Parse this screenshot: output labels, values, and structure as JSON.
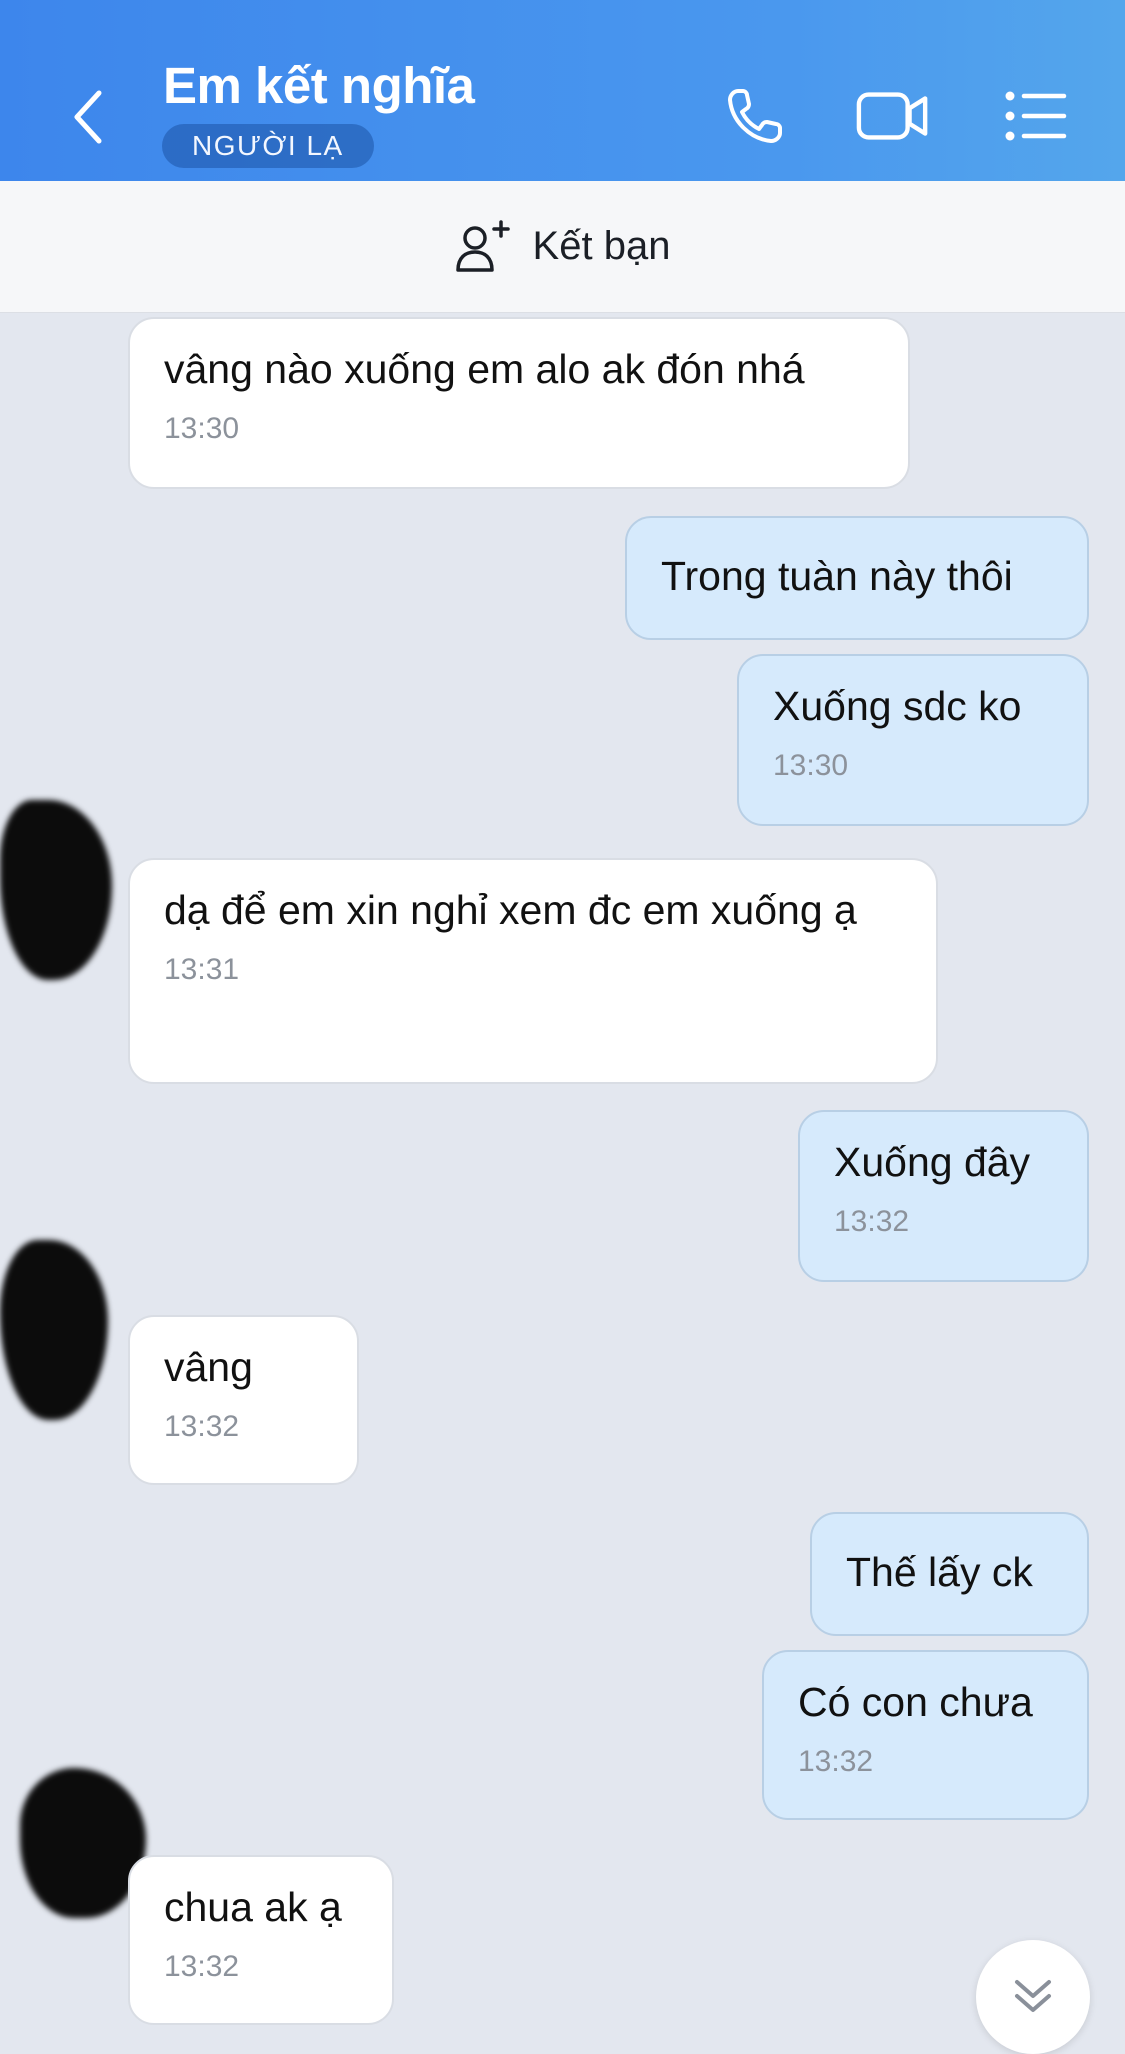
{
  "header": {
    "title": "Em kết nghĩa",
    "badge": "NGƯỜI LẠ"
  },
  "add_friend": {
    "label": "Kết bạn"
  },
  "messages": [
    {
      "side": "received",
      "text": "vâng nào xuống em alo ak đón nhá",
      "time": "13:30"
    },
    {
      "side": "sent",
      "text": "Trong tuàn này thôi",
      "time": ""
    },
    {
      "side": "sent",
      "text": "Xuống sdc ko",
      "time": "13:30"
    },
    {
      "side": "received",
      "text": "dạ để em xin nghỉ xem đc em xuống ạ",
      "time": "13:31"
    },
    {
      "side": "sent",
      "text": "Xuống đây",
      "time": "13:32"
    },
    {
      "side": "received",
      "text": "vâng",
      "time": "13:32"
    },
    {
      "side": "sent",
      "text": "Thế lấy ck",
      "time": ""
    },
    {
      "side": "sent",
      "text": "Có con chưa",
      "time": "13:32"
    },
    {
      "side": "received",
      "text": "chua ak ạ",
      "time": "13:32"
    }
  ],
  "icons": {
    "back": "chevron-left-icon",
    "call": "phone-icon",
    "video": "video-camera-icon",
    "menu": "list-menu-icon",
    "add_friend": "user-plus-icon",
    "scroll": "double-chevron-down-icon"
  },
  "colors": {
    "header_gradient_start": "#3d86ec",
    "header_gradient_end": "#54a6ec",
    "sent_bubble": "#d6eafc",
    "received_bubble": "#ffffff",
    "background": "#e3e7ef"
  }
}
